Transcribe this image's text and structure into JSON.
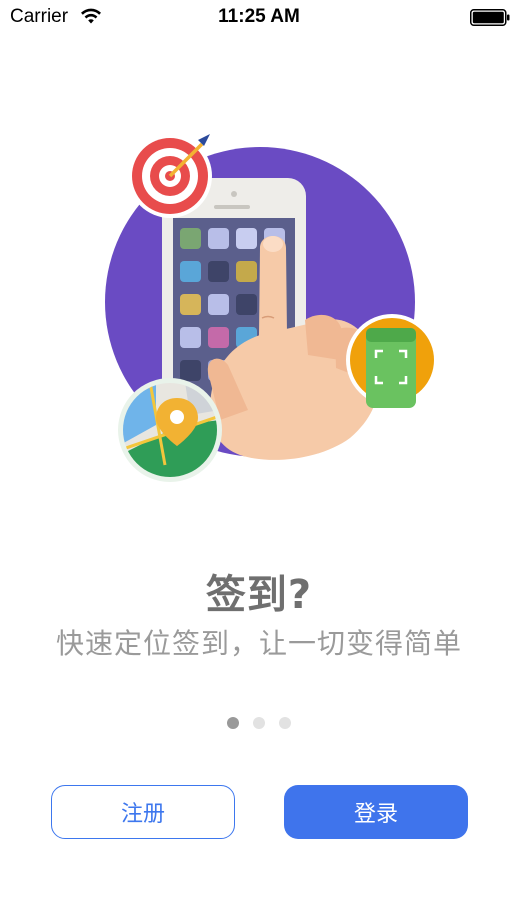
{
  "status_bar": {
    "carrier": "Carrier",
    "time": "11:25 AM",
    "wifi_icon": "wifi-icon",
    "battery_icon": "battery-full-icon"
  },
  "illustration": {
    "description_icons": [
      "target-icon",
      "phone-icon",
      "hand-icon",
      "map-pin-icon",
      "scan-icon"
    ],
    "colors": {
      "circle": "#6a4bc3",
      "target": "#e84c4c",
      "map_green": "#2f9d57",
      "map_blue": "#6fb4ea",
      "pin": "#f2b233",
      "scan_bg": "#f0a10b",
      "scan_phone": "#6ac260",
      "skin": "#f6caa8"
    }
  },
  "onboarding": {
    "title": "签到?",
    "subtitle": "快速定位签到，让一切变得简单",
    "page_count": 3,
    "current_page": 1
  },
  "actions": {
    "register_label": "注册",
    "login_label": "登录"
  },
  "colors": {
    "accent": "#3f74ec",
    "title_text": "#6f6f6f",
    "subtitle_text": "#9a9a9a"
  }
}
